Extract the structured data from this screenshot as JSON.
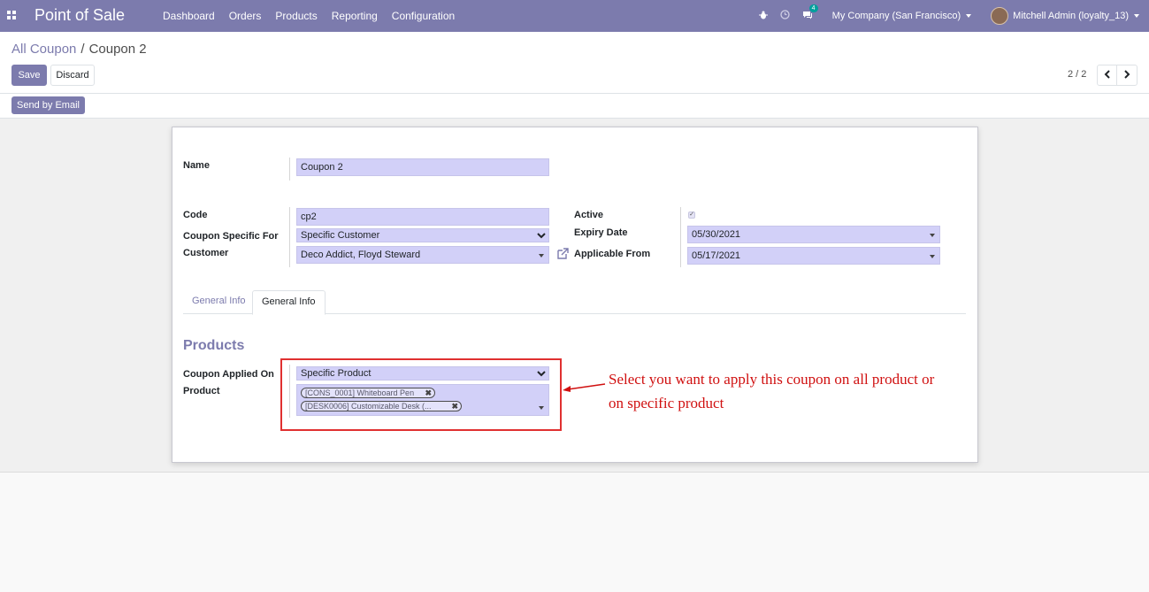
{
  "navbar": {
    "app_title": "Point of Sale",
    "menu": [
      "Dashboard",
      "Orders",
      "Products",
      "Reporting",
      "Configuration"
    ],
    "chat_count": "4",
    "company": "My Company (San Francisco)",
    "user": "Mitchell Admin (loyalty_13)",
    "icons": [
      "apps-icon",
      "bug-icon",
      "clock-icon",
      "chat-icon"
    ]
  },
  "breadcrumb": {
    "parent": "All Coupon",
    "separator": "/",
    "current": "Coupon 2"
  },
  "buttons": {
    "save": "Save",
    "discard": "Discard",
    "send_by_email": "Send by Email"
  },
  "pager": {
    "value": "2 / 2"
  },
  "form": {
    "name_label": "Name",
    "name_value": "Coupon 2",
    "code_label": "Code",
    "code_value": "cp2",
    "specific_for_label": "Coupon Specific For",
    "specific_for_value": "Specific Customer",
    "customer_label": "Customer",
    "customer_value": "Deco Addict, Floyd Steward",
    "active_label": "Active",
    "active_checked": true,
    "expiry_label": "Expiry Date",
    "expiry_value": "05/30/2021",
    "applicable_from_label": "Applicable From",
    "applicable_from_value": "05/17/2021"
  },
  "tabs": [
    "General Info",
    "General Info"
  ],
  "products_section": {
    "title": "Products",
    "applied_on_label": "Coupon Applied On",
    "applied_on_value": "Specific Product",
    "product_label": "Product",
    "tags": [
      "[CONS_0001] Whiteboard Pen",
      "[DESK0006] Customizable Desk (..."
    ]
  },
  "annotation": {
    "text_line1": "Select you want to apply this coupon on all product or",
    "text_line2": "on  specific product",
    "color": "#d01010"
  },
  "colors": {
    "navbar": "#7c7bad",
    "primary": "#7c7bad",
    "field_bg": "#d2d0f8",
    "highlight": "#e03030"
  }
}
